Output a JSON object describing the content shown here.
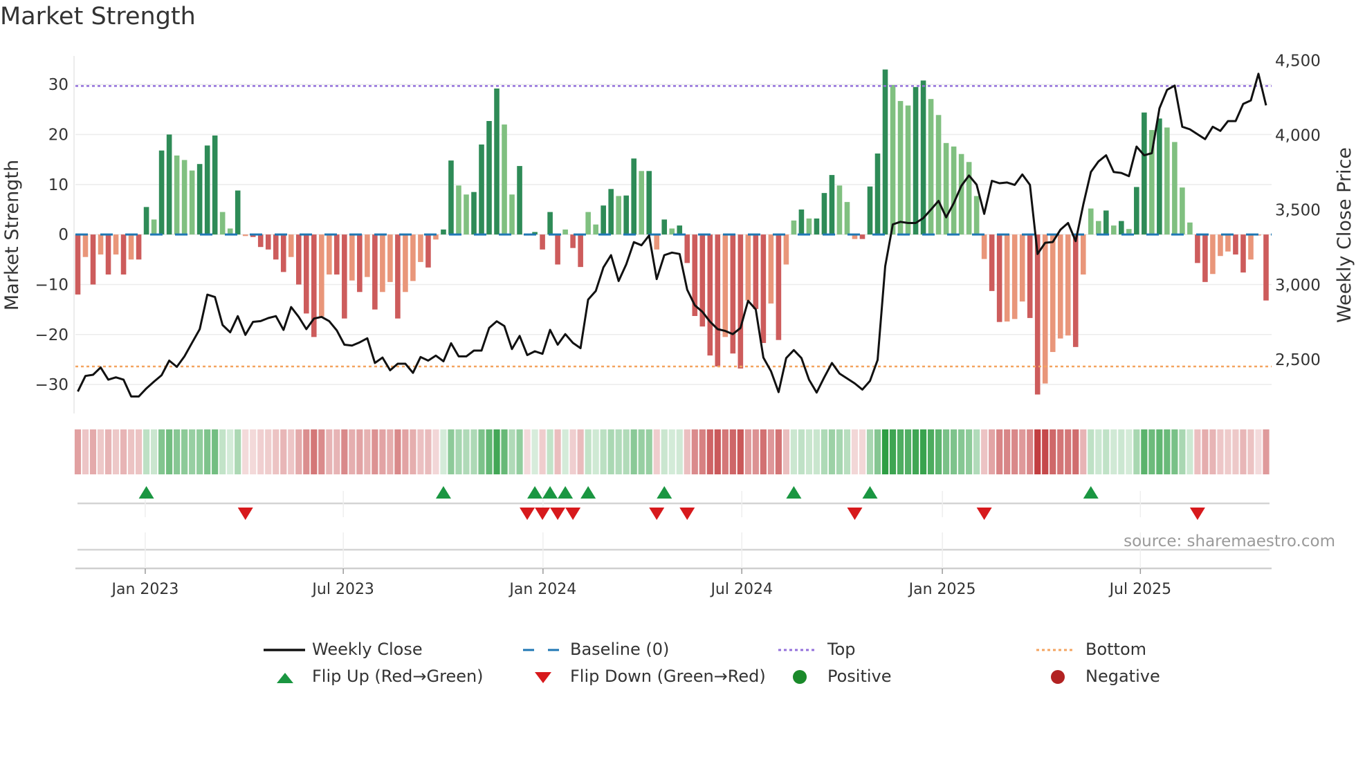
{
  "title": "Market Strength",
  "source": "source: sharemaestro.com",
  "legend": [
    {
      "label": "Weekly Close",
      "symbol": "line-solid",
      "color": "#111111"
    },
    {
      "label": "Baseline (0)",
      "symbol": "line-dashed",
      "color": "#1f77b4"
    },
    {
      "label": "Top",
      "symbol": "line-dotted",
      "color": "#9370db"
    },
    {
      "label": "Bottom",
      "symbol": "line-dotted",
      "color": "#f4a460"
    },
    {
      "label": "Flip Up (Red→Green)",
      "symbol": "triangle-up",
      "color": "#1a9641"
    },
    {
      "label": "Flip Down (Green→Red)",
      "symbol": "triangle-down",
      "color": "#d7191c"
    },
    {
      "label": "Positive",
      "symbol": "circle",
      "color": "#1a8a2a"
    },
    {
      "label": "Negative",
      "symbol": "circle",
      "color": "#b22222"
    }
  ],
  "chart_data": {
    "type": "bar+line",
    "title": "Market Strength",
    "ylabel": "Market Strength",
    "y2label": "Weekly Close Price",
    "ylim": [
      -35.8,
      35.7
    ],
    "y2lim": [
      2139,
      4530
    ],
    "yticks": [
      -30,
      -20,
      -10,
      0,
      10,
      20,
      30
    ],
    "ytick_labels": [
      "−30",
      "−20",
      "−10",
      "0",
      "10",
      "20",
      "30"
    ],
    "y2ticks": [
      2500,
      3000,
      3500,
      4000,
      4500
    ],
    "y2tick_labels": [
      "2,500",
      "3,000",
      "3,500",
      "4,000",
      "4,500"
    ],
    "x_unit": "week index",
    "xticks": [
      8.85,
      34.85,
      61.07,
      87.17,
      113.5,
      139.5
    ],
    "xtick_labels": [
      "Jan 2023",
      "Jul 2023",
      "Jan 2024",
      "Jul 2024",
      "Jan 2025",
      "Jul 2025"
    ],
    "top_level": 29.7,
    "bottom_level": -26.4,
    "baseline": 0,
    "grid": true,
    "legend_position": "bottom",
    "colors": {
      "pos_strong": "#2e8b57",
      "pos_weak": "#80c080",
      "neg_strong": "#cd5c5c",
      "neg_weak": "#e9967a",
      "close": "#111111",
      "baseline": "#1f77b4",
      "top": "#9370db",
      "bottom": "#f4a460",
      "flip_up": "#1a9641",
      "flip_down": "#d7191c"
    },
    "strength": [
      -12,
      -4.5,
      -10,
      -4,
      -8,
      -4,
      -8,
      -5,
      -5,
      5.5,
      3,
      16.8,
      20,
      15.8,
      14.9,
      12.8,
      14.1,
      17.8,
      19.8,
      4.5,
      1.2,
      8.8,
      -0.3,
      -0.5,
      -2.5,
      -3,
      -5,
      -7.5,
      -4.5,
      -10,
      -15.8,
      -20.5,
      -16.4,
      -8,
      -8,
      -16.8,
      -9.2,
      -11.5,
      -8.5,
      -15,
      -11.5,
      -9.5,
      -16.8,
      -11.5,
      -9.3,
      -5.5,
      -6.6,
      -1,
      1,
      14.8,
      9.8,
      8,
      8.5,
      18,
      22.7,
      29.2,
      22,
      8,
      13.7,
      -0.2,
      0.5,
      -3,
      4.5,
      -6,
      1,
      -2.7,
      -6.5,
      4.5,
      2,
      5.8,
      9.1,
      7.7,
      7.8,
      15.2,
      12.7,
      12.7,
      -3,
      3,
      1.2,
      1.8,
      -5.7,
      -16.3,
      -18.4,
      -24.2,
      -26.4,
      -20.5,
      -23.8,
      -26.8,
      -13.2,
      -14.9,
      -21.7,
      -13.8,
      -21.1,
      -6,
      2.8,
      5,
      3.2,
      3.2,
      8.3,
      11.9,
      9.8,
      6.5,
      -0.9,
      -0.9,
      9.6,
      16.2,
      33,
      29.9,
      26.7,
      25.8,
      29.5,
      30.8,
      27.1,
      23.9,
      18.3,
      17.6,
      16.1,
      14.5,
      7.7,
      -4.9,
      -11.3,
      -17.5,
      -17.4,
      -16.9,
      -13.4,
      -16.7,
      -32,
      -29.8,
      -23.5,
      -20.8,
      -20.2,
      -22.5,
      -8,
      5.2,
      2.7,
      4.8,
      1.8,
      2.7,
      1.1,
      9.5,
      24.4,
      20.9,
      23.2,
      21.4,
      18.5,
      9.4,
      2.4,
      -5.7,
      -9.5,
      -7.9,
      -4.3,
      -3.4,
      -4,
      -7.6,
      -5,
      -0.2,
      -13.2
    ],
    "close": [
      2286,
      2390,
      2398,
      2447,
      2365,
      2381,
      2365,
      2253,
      2253,
      2307,
      2352,
      2395,
      2493,
      2451,
      2521,
      2612,
      2703,
      2934,
      2918,
      2731,
      2682,
      2790,
      2665,
      2752,
      2757,
      2777,
      2790,
      2698,
      2851,
      2785,
      2703,
      2774,
      2785,
      2757,
      2695,
      2599,
      2593,
      2615,
      2642,
      2477,
      2513,
      2428,
      2472,
      2472,
      2411,
      2517,
      2493,
      2526,
      2488,
      2609,
      2521,
      2521,
      2560,
      2560,
      2711,
      2756,
      2724,
      2570,
      2658,
      2530,
      2555,
      2538,
      2698,
      2599,
      2670,
      2611,
      2576,
      2901,
      2959,
      3116,
      3198,
      3025,
      3137,
      3285,
      3264,
      3330,
      3038,
      3198,
      3215,
      3206,
      2967,
      2863,
      2819,
      2753,
      2703,
      2691,
      2670,
      2711,
      2893,
      2835,
      2513,
      2422,
      2282,
      2510,
      2563,
      2510,
      2365,
      2279,
      2381,
      2477,
      2406,
      2373,
      2340,
      2299,
      2357,
      2497,
      3124,
      3404,
      3421,
      3413,
      3413,
      3446,
      3503,
      3561,
      3451,
      3546,
      3662,
      3731,
      3670,
      3474,
      3695,
      3679,
      3684,
      3668,
      3738,
      3668,
      3206,
      3281,
      3286,
      3368,
      3413,
      3292,
      3536,
      3754,
      3825,
      3866,
      3754,
      3748,
      3726,
      3924,
      3866,
      3880,
      4180,
      4304,
      4332,
      4057,
      4040,
      4007,
      3974,
      4057,
      4029,
      4095,
      4095,
      4210,
      4233,
      4411,
      4200
    ]
  }
}
